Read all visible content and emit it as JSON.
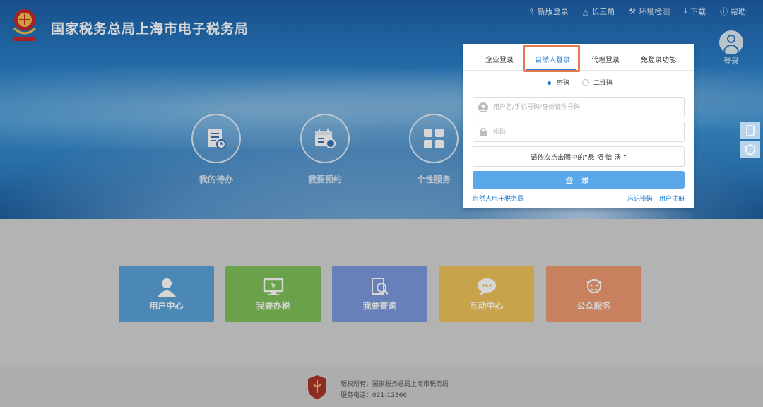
{
  "header": {
    "site_title": "国家税务总局上海市电子税务局",
    "nav": [
      {
        "label": "新版登录",
        "icon": "upload-icon"
      },
      {
        "label": "长三角",
        "icon": "triangle-icon"
      },
      {
        "label": "环境检测",
        "icon": "wrench-icon"
      },
      {
        "label": "下载",
        "icon": "download-icon"
      },
      {
        "label": "帮助",
        "icon": "help-icon"
      }
    ],
    "login_label": "登录"
  },
  "quick_links": [
    {
      "label": "我的待办",
      "icon": "todo-icon"
    },
    {
      "label": "我要预约",
      "icon": "calendar-icon"
    },
    {
      "label": "个性服务",
      "icon": "grid-icon"
    }
  ],
  "login_panel": {
    "tabs": [
      "企业登录",
      "自然人登录",
      "代理登录",
      "免登录功能"
    ],
    "active_tab": "自然人登录",
    "radios": [
      {
        "label": "密码",
        "selected": true
      },
      {
        "label": "二维码",
        "selected": false
      }
    ],
    "username_placeholder": "用户名/手机号码/身份证件号码",
    "password_placeholder": "密码",
    "captcha_prompt": "请依次点击图中的“悬 损 恰 沃 ”",
    "submit_label": "登 录",
    "bottom_left_link": "自然人电子税务局",
    "forgot_password": "忘记密码",
    "register": "用户注册",
    "link_separator": "|",
    "accent_color": "#1a7ad0",
    "highlight_color": "#e8794f"
  },
  "side_widgets": [
    {
      "icon": "mobile-icon"
    },
    {
      "icon": "shield-icon"
    }
  ],
  "service_tiles": [
    {
      "label": "用户中心",
      "icon": "user-icon",
      "color": "#5aa3d8"
    },
    {
      "label": "我要办税",
      "icon": "monitor-icon",
      "color": "#7fc25a"
    },
    {
      "label": "我要查询",
      "icon": "search-doc-icon",
      "color": "#7b99dd"
    },
    {
      "label": "互动中心",
      "icon": "chat-icon",
      "color": "#efc35a"
    },
    {
      "label": "公众服务",
      "icon": "public-service-icon",
      "color": "#ef9a72"
    }
  ],
  "footer": {
    "copyright": "版权所有：国家税务总局上海市税务局",
    "phone": "服务电话：021-12366"
  }
}
